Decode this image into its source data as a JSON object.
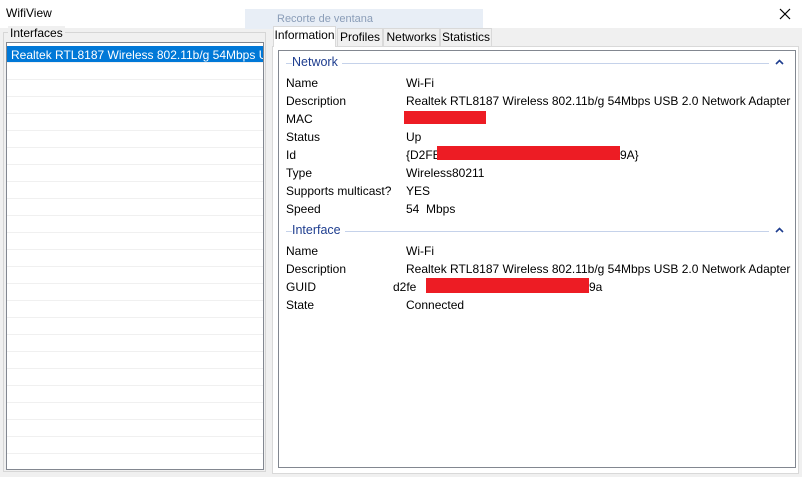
{
  "window": {
    "title": "WifiView",
    "ghost_text": "Recorte de ventana"
  },
  "interfaces": {
    "group_label": "Interfaces",
    "items": [
      "Realtek RTL8187 Wireless 802.11b/g 54Mbps U..."
    ]
  },
  "tabs": [
    "Information",
    "Profiles",
    "Networks",
    "Statistics"
  ],
  "network": {
    "title": "Network",
    "rows": [
      {
        "label": "Name",
        "value": "Wi-Fi"
      },
      {
        "label": "Description",
        "value": "Realtek RTL8187 Wireless 802.11b/g 54Mbps USB 2.0 Network Adapter"
      },
      {
        "label": "MAC",
        "value": ""
      },
      {
        "label": "Status",
        "value": "Up"
      },
      {
        "label": "Id",
        "value_prefix": "{D2FE",
        "value_suffix": "9A}"
      },
      {
        "label": "Type",
        "value": "Wireless80211"
      },
      {
        "label": "Supports multicast?",
        "value": "YES"
      },
      {
        "label": "Speed",
        "value": "54  Mbps"
      }
    ]
  },
  "interface": {
    "title": "Interface",
    "rows": [
      {
        "label": "Name",
        "value": "Wi-Fi"
      },
      {
        "label": "Description",
        "value": "Realtek RTL8187 Wireless 802.11b/g 54Mbps USB 2.0 Network Adapter"
      },
      {
        "label": "GUID",
        "value_prefix": "d2fe",
        "value_suffix": "9a"
      },
      {
        "label": "State",
        "value": "Connected"
      }
    ]
  },
  "colors": {
    "accent": "#0078d7",
    "section_title": "#1e3d8f",
    "redaction": "#ed1c24"
  }
}
